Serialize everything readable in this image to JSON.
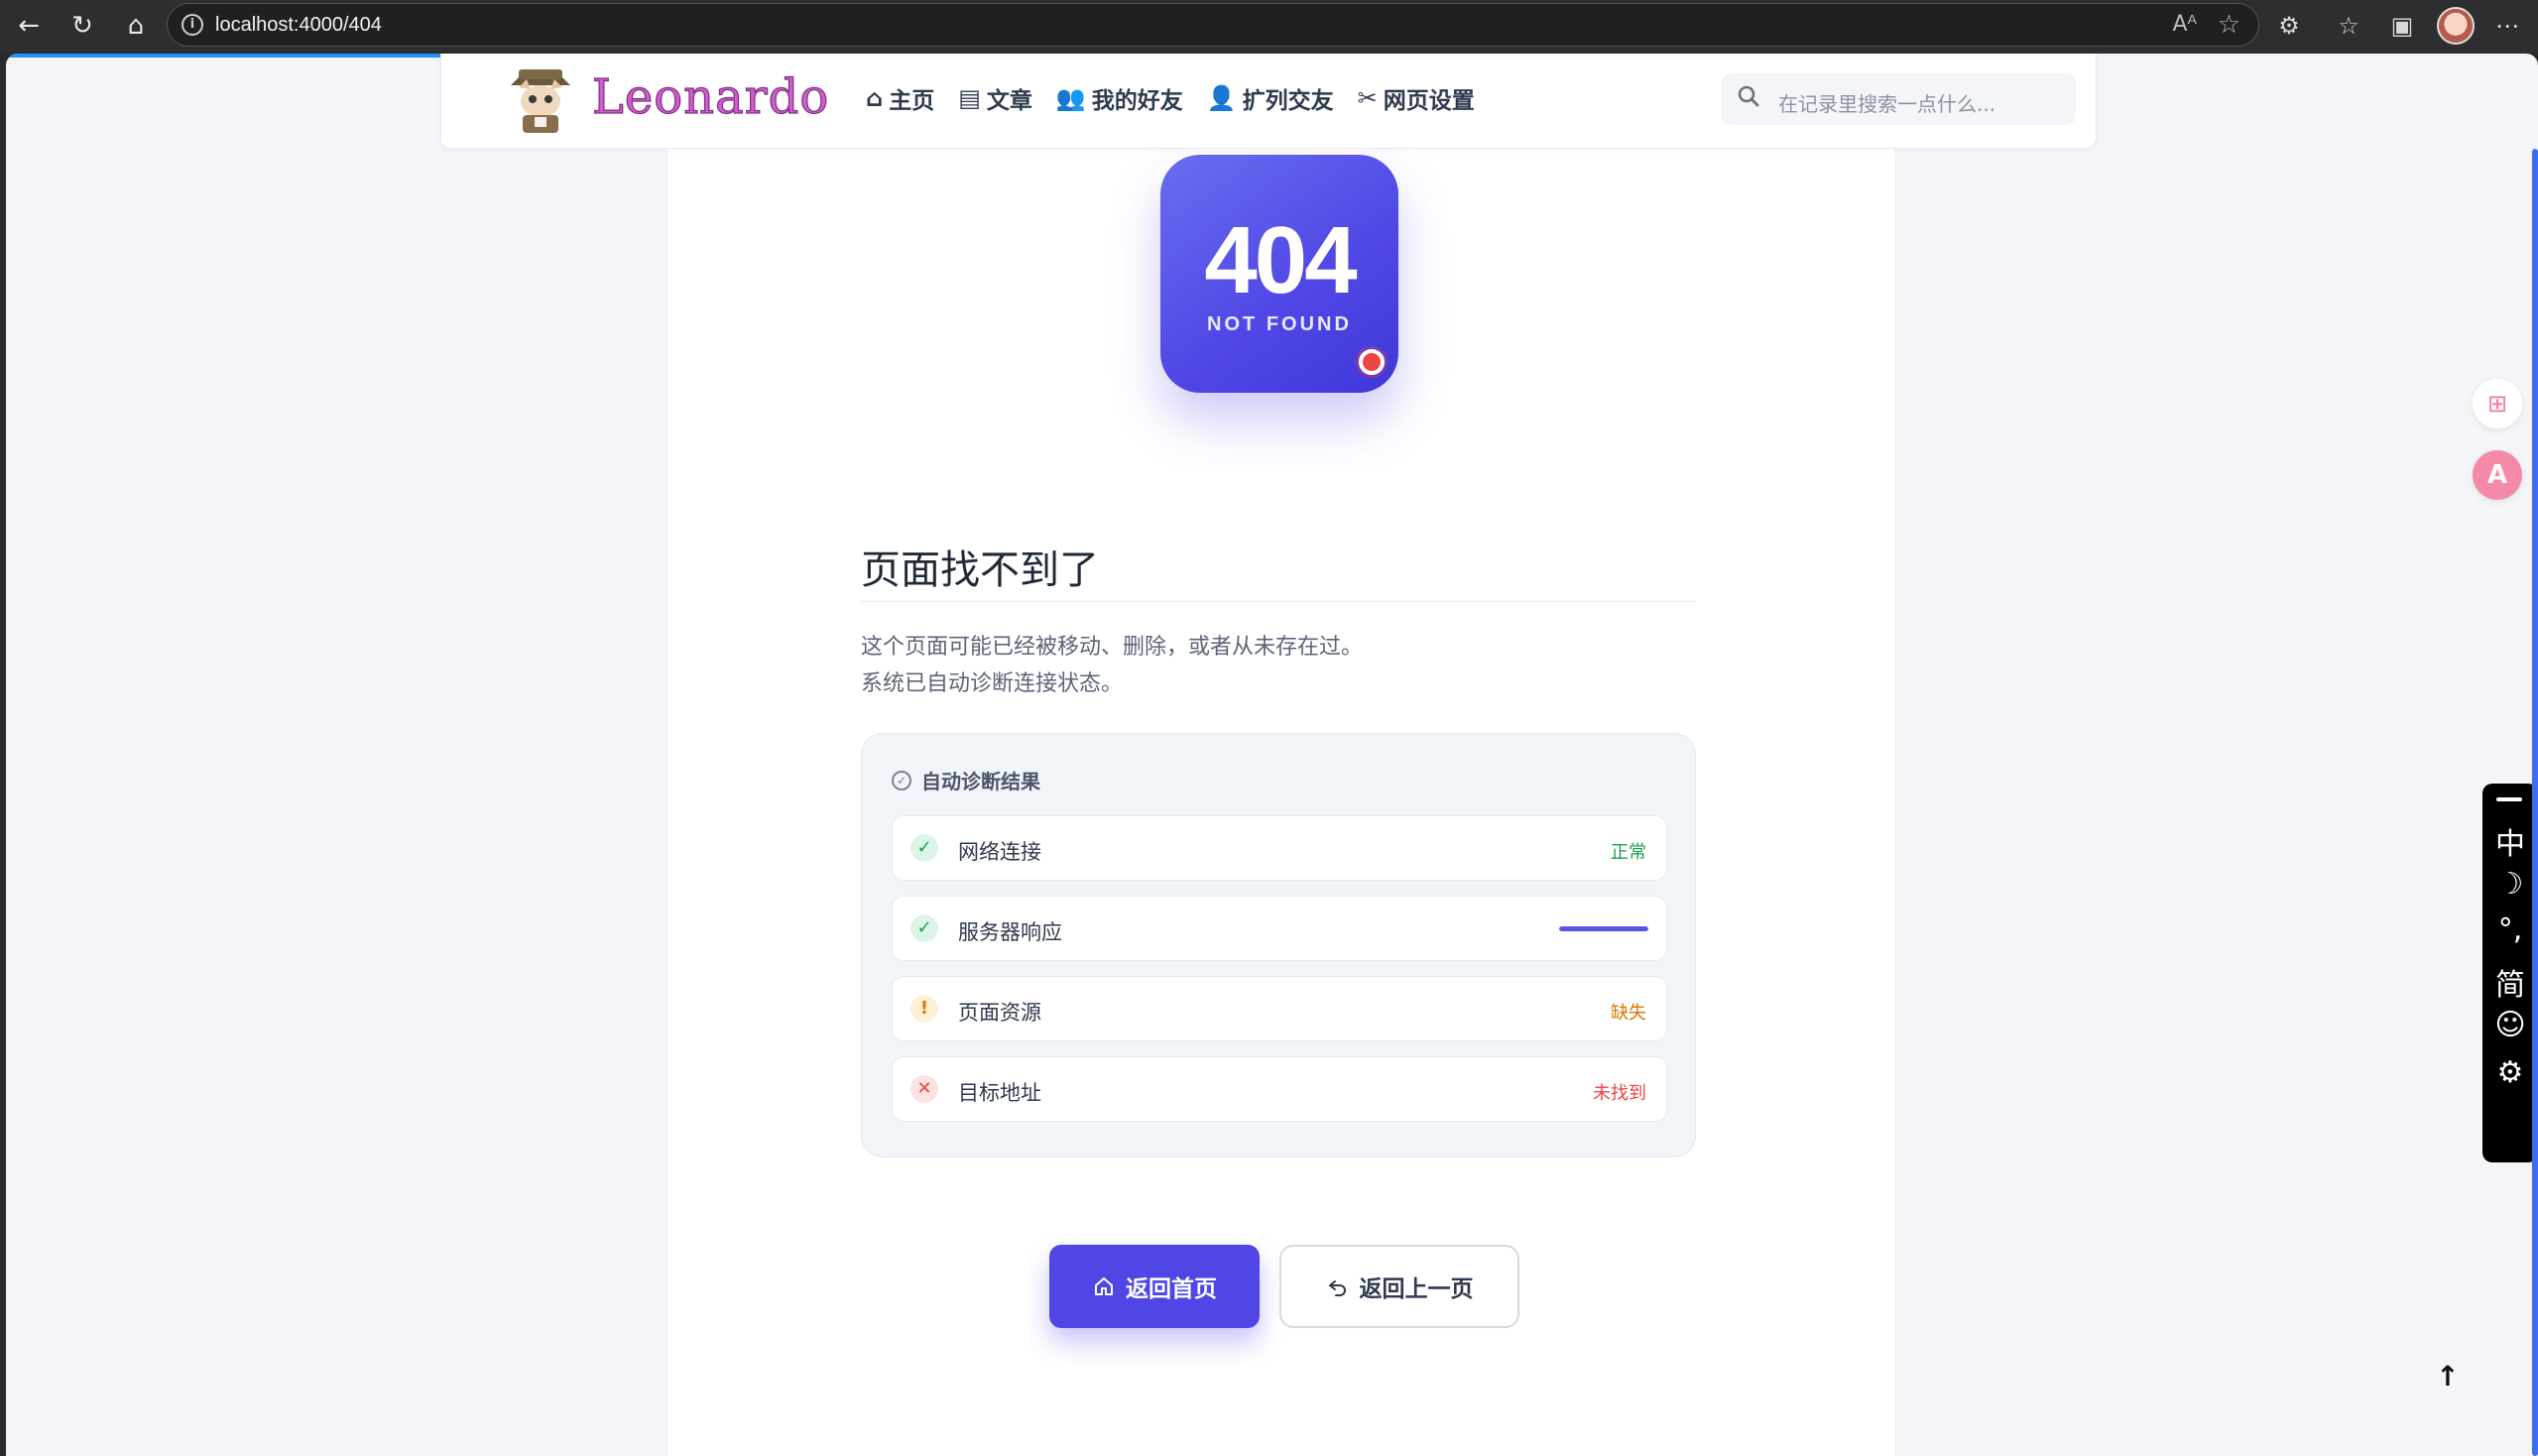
{
  "browser": {
    "url": "localhost:4000/404"
  },
  "header": {
    "brand": "Leonardo",
    "nav": [
      {
        "label": "主页",
        "icon": "home-icon"
      },
      {
        "label": "文章",
        "icon": "article-icon"
      },
      {
        "label": "我的好友",
        "icon": "friends-icon"
      },
      {
        "label": "扩列交友",
        "icon": "add-friend-icon"
      },
      {
        "label": "网页设置",
        "icon": "tools-icon"
      }
    ],
    "search_placeholder": "在记录里搜索一点什么..."
  },
  "error": {
    "code": "404",
    "subtitle": "NOT FOUND",
    "title": "页面找不到了",
    "desc_line1": "这个页面可能已经被移动、删除，或者从未存在过。",
    "desc_line2": "系统已自动诊断连接状态。"
  },
  "diagnostics": {
    "heading": "自动诊断结果",
    "items": [
      {
        "label": "网络连接",
        "status": "ok",
        "value": "正常"
      },
      {
        "label": "服务器响应",
        "status": "ok",
        "value": "",
        "progress": 1.0
      },
      {
        "label": "页面资源",
        "status": "warn",
        "value": "缺失"
      },
      {
        "label": "目标地址",
        "status": "err",
        "value": "未找到"
      }
    ]
  },
  "actions": {
    "home": "返回首页",
    "back": "返回上一页"
  },
  "ime": {
    "keys": [
      "中",
      "☽",
      "°,",
      "简",
      "☺",
      "⚙"
    ]
  },
  "colors": {
    "accent": "#4f46e5",
    "ok": "#16a34a",
    "warn": "#d97706",
    "err": "#ef4444",
    "brand": "#d35cc9"
  }
}
